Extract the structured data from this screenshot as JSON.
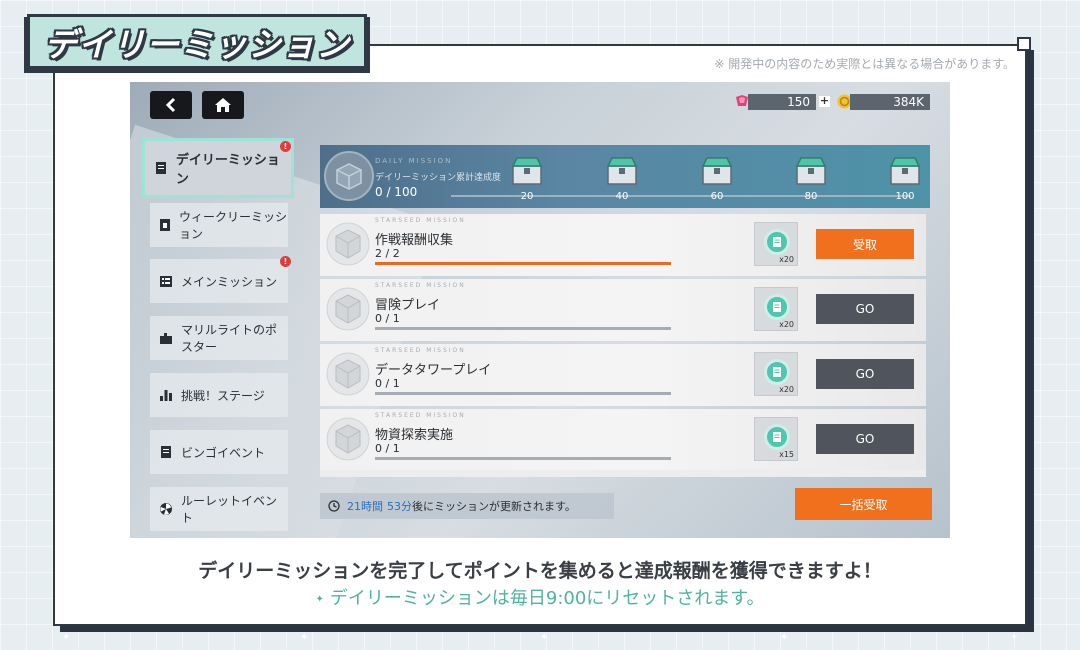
{
  "page": {
    "title": "デイリーミッション",
    "disclaimer": "※ 開発中の内容のため実際とは異なる場合があります。",
    "caption": "デイリーミッションを完了してポイントを集めると達成報酬を獲得できますよ！",
    "note": "デイリーミッションは毎日9:00にリセットされます。",
    "note_marker": "✦"
  },
  "topbar": {
    "back_icon": "back-arrow-icon",
    "home_icon": "home-icon",
    "currency1_value": "150",
    "currency1_plus": "+",
    "currency2_value": "384K"
  },
  "sidebar": {
    "items": [
      {
        "label": "デイリーミッション",
        "icon": "document-icon",
        "active": true,
        "alert": true
      },
      {
        "label": "ウィークリーミッション",
        "icon": "calendar-icon",
        "active": false,
        "alert": false
      },
      {
        "label": "メインミッション",
        "icon": "list-icon",
        "active": false,
        "alert": true
      },
      {
        "label": "マリルライトのポスター",
        "icon": "puzzle-icon",
        "active": false,
        "alert": false
      },
      {
        "label": "挑戦！ステージ",
        "icon": "bar-chart-icon",
        "active": false,
        "alert": false
      },
      {
        "label": "ビンゴイベント",
        "icon": "document-icon",
        "active": false,
        "alert": false
      },
      {
        "label": "ルーレットイベント",
        "icon": "roulette-icon",
        "active": false,
        "alert": false
      }
    ],
    "alert_mark": "!"
  },
  "progress": {
    "small_label": "DAILY MISSION",
    "label": "デイリーミッション累計達成度",
    "value": "0 / 100",
    "current": 0,
    "max": 100,
    "milestones": [
      "20",
      "40",
      "60",
      "80",
      "100"
    ]
  },
  "missions": [
    {
      "tag": "STARSEED MISSION",
      "name": "作戦報酬収集",
      "progress": "2 / 2",
      "fraction": 1.0,
      "reward_qty": "x20",
      "button": "受取",
      "state": "claim"
    },
    {
      "tag": "STARSEED MISSION",
      "name": "冒険プレイ",
      "progress": "0 / 1",
      "fraction": 0.0,
      "reward_qty": "x20",
      "button": "GO",
      "state": "go"
    },
    {
      "tag": "STARSEED MISSION",
      "name": "データタワープレイ",
      "progress": "0 / 1",
      "fraction": 0.0,
      "reward_qty": "x20",
      "button": "GO",
      "state": "go"
    },
    {
      "tag": "STARSEED MISSION",
      "name": "物資探索実施",
      "progress": "0 / 1",
      "fraction": 0.0,
      "reward_qty": "x15",
      "button": "GO",
      "state": "go"
    }
  ],
  "footer": {
    "timer_hours": "21時間",
    "timer_minutes": "53分",
    "timer_suffix": "後にミッションが更新されます。",
    "claim_all": "一括受取"
  },
  "colors": {
    "accent_orange": "#f0701d",
    "accent_teal": "#4fb3a1",
    "frame_dark": "#2f3946",
    "alert_red": "#e23b3b"
  }
}
